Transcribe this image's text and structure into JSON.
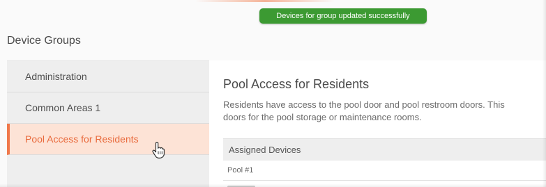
{
  "toast": {
    "message": "Devices for group updated successfully"
  },
  "page": {
    "title": "Device Groups"
  },
  "sidebar": {
    "items": [
      {
        "label": "Administration",
        "selected": false
      },
      {
        "label": "Common Areas 1",
        "selected": false
      },
      {
        "label": "Pool Access for Residents",
        "selected": true
      }
    ]
  },
  "group": {
    "title": "Pool Access for Residents",
    "description_line1": "Residents have access to the pool door and pool restroom doors. This",
    "description_line2": "doors for the pool storage or maintenance rooms."
  },
  "devices_table": {
    "header": "Assigned Devices",
    "rows": [
      "Pool #1"
    ]
  },
  "colors": {
    "toast_bg": "#3c9a32",
    "selected_text": "#e96a3c",
    "selected_bg": "#fde3d6",
    "selected_border": "#f0784a"
  },
  "icons": {
    "cursor": "hand-pointer-icon"
  }
}
